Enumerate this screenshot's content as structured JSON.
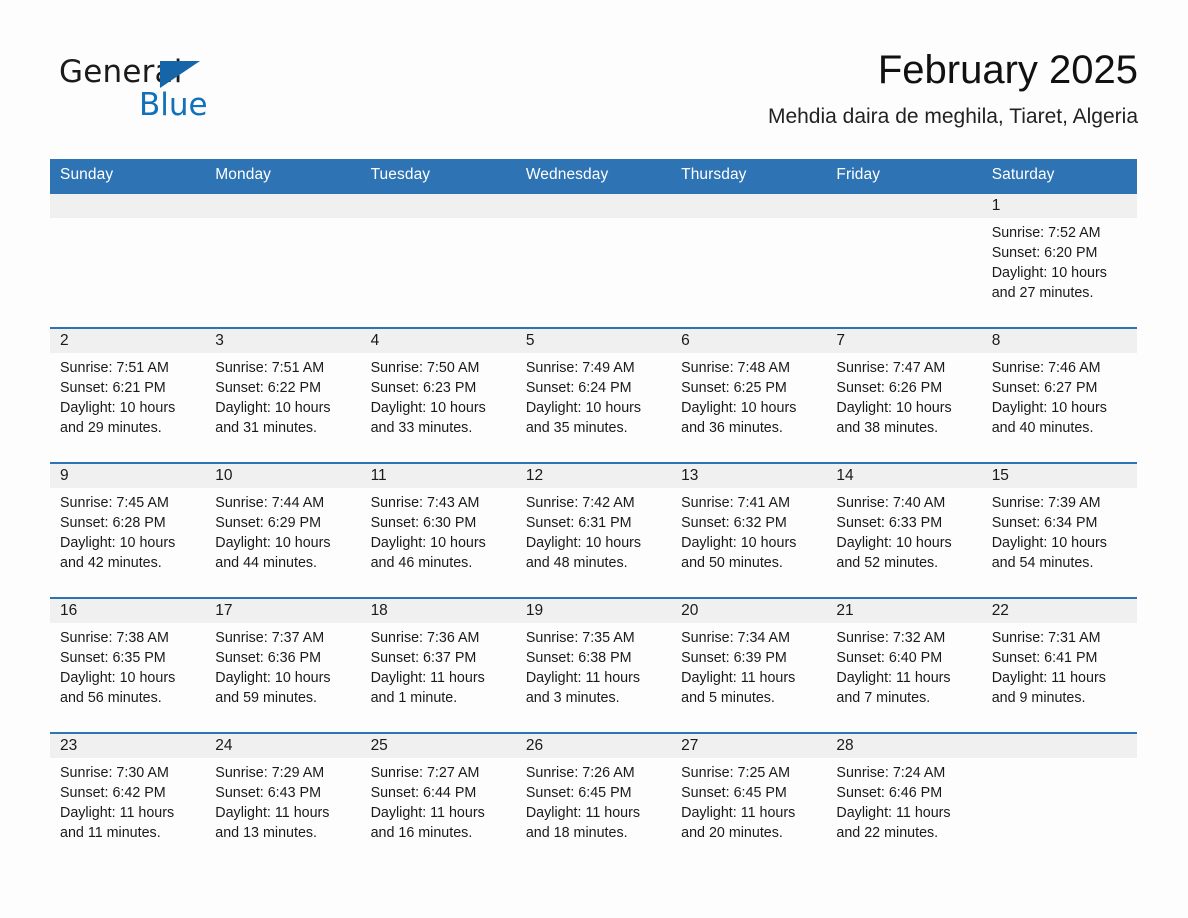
{
  "brand": {
    "name_part1": "General",
    "name_part2": "Blue",
    "triangle_icon": "blue-triangle-logo-mark",
    "accent_color": "#1171bb"
  },
  "header": {
    "title": "February 2025",
    "subtitle": "Mehdia daira de meghila, Tiaret, Algeria"
  },
  "theme": {
    "header_blue": "#2e74b5",
    "date_strip_gray": "#f0f0f0",
    "page_background": "#fdfdfd",
    "text_color": "#1a1a1a"
  },
  "calendar": {
    "weekday_headers": [
      "Sunday",
      "Monday",
      "Tuesday",
      "Wednesday",
      "Thursday",
      "Friday",
      "Saturday"
    ],
    "weeks": [
      [
        {
          "day": "",
          "lines": []
        },
        {
          "day": "",
          "lines": []
        },
        {
          "day": "",
          "lines": []
        },
        {
          "day": "",
          "lines": []
        },
        {
          "day": "",
          "lines": []
        },
        {
          "day": "",
          "lines": []
        },
        {
          "day": "1",
          "lines": [
            "Sunrise: 7:52 AM",
            "Sunset: 6:20 PM",
            "Daylight: 10 hours and 27 minutes."
          ],
          "sunrise": "7:52 AM",
          "sunset": "6:20 PM",
          "daylight": "10 hours and 27 minutes."
        }
      ],
      [
        {
          "day": "2",
          "lines": [
            "Sunrise: 7:51 AM",
            "Sunset: 6:21 PM",
            "Daylight: 10 hours and 29 minutes."
          ],
          "sunrise": "7:51 AM",
          "sunset": "6:21 PM",
          "daylight": "10 hours and 29 minutes."
        },
        {
          "day": "3",
          "lines": [
            "Sunrise: 7:51 AM",
            "Sunset: 6:22 PM",
            "Daylight: 10 hours and 31 minutes."
          ],
          "sunrise": "7:51 AM",
          "sunset": "6:22 PM",
          "daylight": "10 hours and 31 minutes."
        },
        {
          "day": "4",
          "lines": [
            "Sunrise: 7:50 AM",
            "Sunset: 6:23 PM",
            "Daylight: 10 hours and 33 minutes."
          ],
          "sunrise": "7:50 AM",
          "sunset": "6:23 PM",
          "daylight": "10 hours and 33 minutes."
        },
        {
          "day": "5",
          "lines": [
            "Sunrise: 7:49 AM",
            "Sunset: 6:24 PM",
            "Daylight: 10 hours and 35 minutes."
          ],
          "sunrise": "7:49 AM",
          "sunset": "6:24 PM",
          "daylight": "10 hours and 35 minutes."
        },
        {
          "day": "6",
          "lines": [
            "Sunrise: 7:48 AM",
            "Sunset: 6:25 PM",
            "Daylight: 10 hours and 36 minutes."
          ],
          "sunrise": "7:48 AM",
          "sunset": "6:25 PM",
          "daylight": "10 hours and 36 minutes."
        },
        {
          "day": "7",
          "lines": [
            "Sunrise: 7:47 AM",
            "Sunset: 6:26 PM",
            "Daylight: 10 hours and 38 minutes."
          ],
          "sunrise": "7:47 AM",
          "sunset": "6:26 PM",
          "daylight": "10 hours and 38 minutes."
        },
        {
          "day": "8",
          "lines": [
            "Sunrise: 7:46 AM",
            "Sunset: 6:27 PM",
            "Daylight: 10 hours and 40 minutes."
          ],
          "sunrise": "7:46 AM",
          "sunset": "6:27 PM",
          "daylight": "10 hours and 40 minutes."
        }
      ],
      [
        {
          "day": "9",
          "lines": [
            "Sunrise: 7:45 AM",
            "Sunset: 6:28 PM",
            "Daylight: 10 hours and 42 minutes."
          ],
          "sunrise": "7:45 AM",
          "sunset": "6:28 PM",
          "daylight": "10 hours and 42 minutes."
        },
        {
          "day": "10",
          "lines": [
            "Sunrise: 7:44 AM",
            "Sunset: 6:29 PM",
            "Daylight: 10 hours and 44 minutes."
          ],
          "sunrise": "7:44 AM",
          "sunset": "6:29 PM",
          "daylight": "10 hours and 44 minutes."
        },
        {
          "day": "11",
          "lines": [
            "Sunrise: 7:43 AM",
            "Sunset: 6:30 PM",
            "Daylight: 10 hours and 46 minutes."
          ],
          "sunrise": "7:43 AM",
          "sunset": "6:30 PM",
          "daylight": "10 hours and 46 minutes."
        },
        {
          "day": "12",
          "lines": [
            "Sunrise: 7:42 AM",
            "Sunset: 6:31 PM",
            "Daylight: 10 hours and 48 minutes."
          ],
          "sunrise": "7:42 AM",
          "sunset": "6:31 PM",
          "daylight": "10 hours and 48 minutes."
        },
        {
          "day": "13",
          "lines": [
            "Sunrise: 7:41 AM",
            "Sunset: 6:32 PM",
            "Daylight: 10 hours and 50 minutes."
          ],
          "sunrise": "7:41 AM",
          "sunset": "6:32 PM",
          "daylight": "10 hours and 50 minutes."
        },
        {
          "day": "14",
          "lines": [
            "Sunrise: 7:40 AM",
            "Sunset: 6:33 PM",
            "Daylight: 10 hours and 52 minutes."
          ],
          "sunrise": "7:40 AM",
          "sunset": "6:33 PM",
          "daylight": "10 hours and 52 minutes."
        },
        {
          "day": "15",
          "lines": [
            "Sunrise: 7:39 AM",
            "Sunset: 6:34 PM",
            "Daylight: 10 hours and 54 minutes."
          ],
          "sunrise": "7:39 AM",
          "sunset": "6:34 PM",
          "daylight": "10 hours and 54 minutes."
        }
      ],
      [
        {
          "day": "16",
          "lines": [
            "Sunrise: 7:38 AM",
            "Sunset: 6:35 PM",
            "Daylight: 10 hours and 56 minutes."
          ],
          "sunrise": "7:38 AM",
          "sunset": "6:35 PM",
          "daylight": "10 hours and 56 minutes."
        },
        {
          "day": "17",
          "lines": [
            "Sunrise: 7:37 AM",
            "Sunset: 6:36 PM",
            "Daylight: 10 hours and 59 minutes."
          ],
          "sunrise": "7:37 AM",
          "sunset": "6:36 PM",
          "daylight": "10 hours and 59 minutes."
        },
        {
          "day": "18",
          "lines": [
            "Sunrise: 7:36 AM",
            "Sunset: 6:37 PM",
            "Daylight: 11 hours and 1 minute."
          ],
          "sunrise": "7:36 AM",
          "sunset": "6:37 PM",
          "daylight": "11 hours and 1 minute."
        },
        {
          "day": "19",
          "lines": [
            "Sunrise: 7:35 AM",
            "Sunset: 6:38 PM",
            "Daylight: 11 hours and 3 minutes."
          ],
          "sunrise": "7:35 AM",
          "sunset": "6:38 PM",
          "daylight": "11 hours and 3 minutes."
        },
        {
          "day": "20",
          "lines": [
            "Sunrise: 7:34 AM",
            "Sunset: 6:39 PM",
            "Daylight: 11 hours and 5 minutes."
          ],
          "sunrise": "7:34 AM",
          "sunset": "6:39 PM",
          "daylight": "11 hours and 5 minutes."
        },
        {
          "day": "21",
          "lines": [
            "Sunrise: 7:32 AM",
            "Sunset: 6:40 PM",
            "Daylight: 11 hours and 7 minutes."
          ],
          "sunrise": "7:32 AM",
          "sunset": "6:40 PM",
          "daylight": "11 hours and 7 minutes."
        },
        {
          "day": "22",
          "lines": [
            "Sunrise: 7:31 AM",
            "Sunset: 6:41 PM",
            "Daylight: 11 hours and 9 minutes."
          ],
          "sunrise": "7:31 AM",
          "sunset": "6:41 PM",
          "daylight": "11 hours and 9 minutes."
        }
      ],
      [
        {
          "day": "23",
          "lines": [
            "Sunrise: 7:30 AM",
            "Sunset: 6:42 PM",
            "Daylight: 11 hours and 11 minutes."
          ],
          "sunrise": "7:30 AM",
          "sunset": "6:42 PM",
          "daylight": "11 hours and 11 minutes."
        },
        {
          "day": "24",
          "lines": [
            "Sunrise: 7:29 AM",
            "Sunset: 6:43 PM",
            "Daylight: 11 hours and 13 minutes."
          ],
          "sunrise": "7:29 AM",
          "sunset": "6:43 PM",
          "daylight": "11 hours and 13 minutes."
        },
        {
          "day": "25",
          "lines": [
            "Sunrise: 7:27 AM",
            "Sunset: 6:44 PM",
            "Daylight: 11 hours and 16 minutes."
          ],
          "sunrise": "7:27 AM",
          "sunset": "6:44 PM",
          "daylight": "11 hours and 16 minutes."
        },
        {
          "day": "26",
          "lines": [
            "Sunrise: 7:26 AM",
            "Sunset: 6:45 PM",
            "Daylight: 11 hours and 18 minutes."
          ],
          "sunrise": "7:26 AM",
          "sunset": "6:45 PM",
          "daylight": "11 hours and 18 minutes."
        },
        {
          "day": "27",
          "lines": [
            "Sunrise: 7:25 AM",
            "Sunset: 6:45 PM",
            "Daylight: 11 hours and 20 minutes."
          ],
          "sunrise": "7:25 AM",
          "sunset": "6:45 PM",
          "daylight": "11 hours and 20 minutes."
        },
        {
          "day": "28",
          "lines": [
            "Sunrise: 7:24 AM",
            "Sunset: 6:46 PM",
            "Daylight: 11 hours and 22 minutes."
          ],
          "sunrise": "7:24 AM",
          "sunset": "6:46 PM",
          "daylight": "11 hours and 22 minutes."
        },
        {
          "day": "",
          "lines": []
        }
      ]
    ]
  }
}
